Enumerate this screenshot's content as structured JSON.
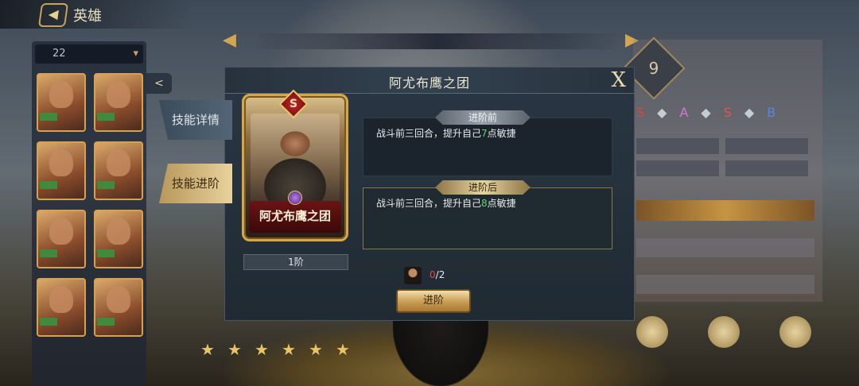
{
  "background": {
    "top_title": "英雄",
    "filter_count": "22"
  },
  "modal": {
    "title": "阿尤布鹰之团",
    "close_label": "X",
    "tabs": [
      {
        "label": "技能详情",
        "active": false
      },
      {
        "label": "技能进阶",
        "active": true
      }
    ],
    "card": {
      "name": "阿尤布鹰之团",
      "grade_badge": "S",
      "rank_label": "1阶"
    },
    "before": {
      "tag": "进阶前",
      "text_prefix": "战斗前三回合，提升自己",
      "value": "7",
      "text_suffix": "点敏捷"
    },
    "after": {
      "tag": "进阶后",
      "text_prefix": "战斗前三回合，提升自己",
      "value": "8",
      "text_suffix": "点敏捷"
    },
    "cost": {
      "have": "0",
      "separator": "/",
      "need": "2"
    },
    "advance_button": "进阶"
  },
  "colors": {
    "accent_gold": "#d6a746",
    "value_green": "#5fd46a",
    "insufficient_red": "#e04a4a"
  },
  "icons": [
    "back-arrow-icon",
    "share-icon",
    "close-icon",
    "grade-s-icon",
    "gem-icon",
    "hero-avatar-icon"
  ]
}
